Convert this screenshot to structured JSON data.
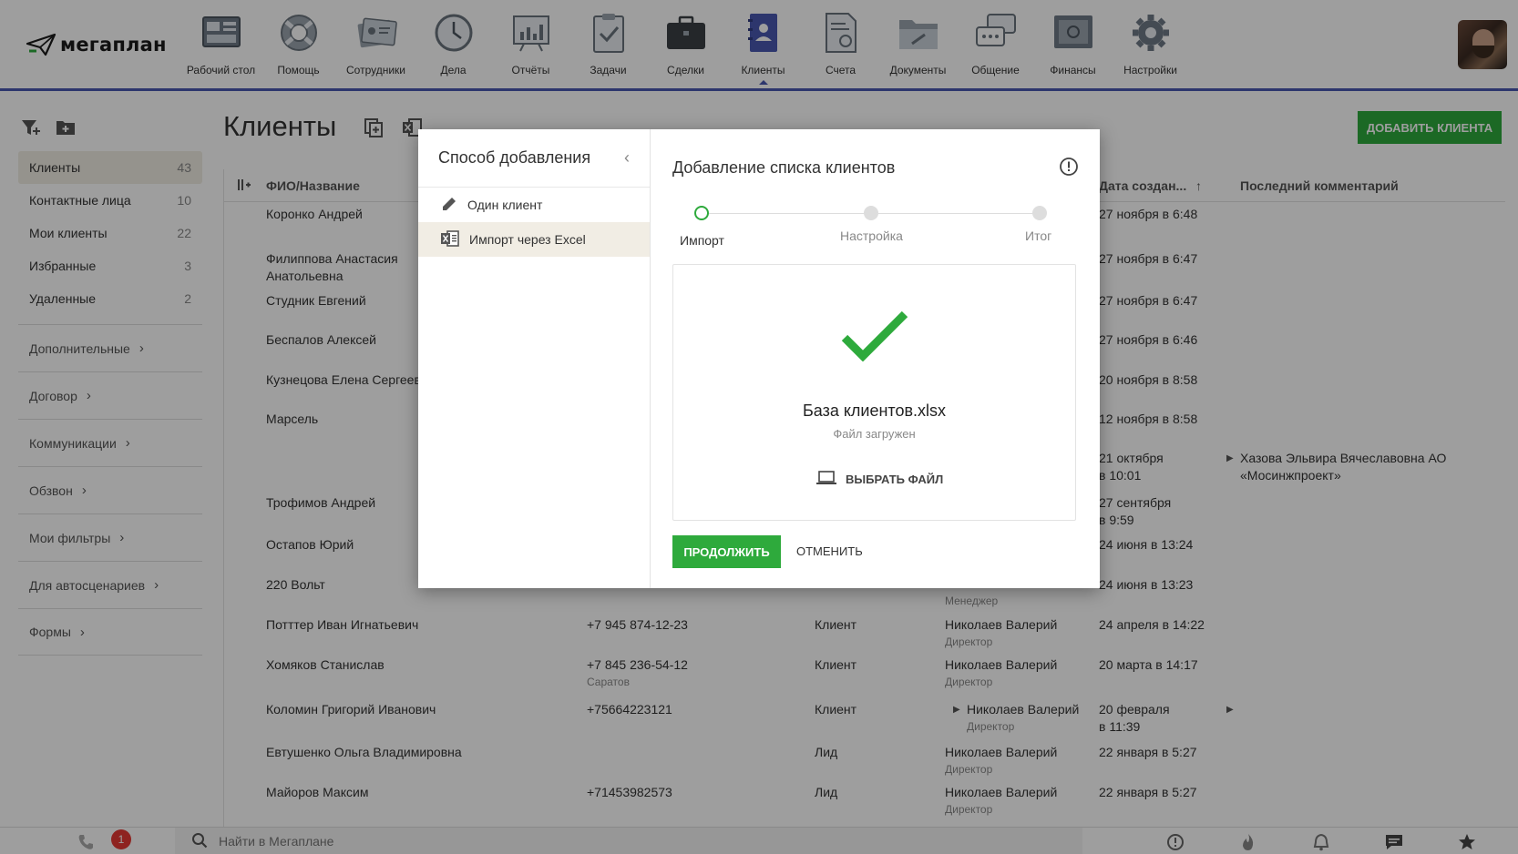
{
  "app": {
    "logo_text": "мегаплан"
  },
  "nav": [
    {
      "label": "Рабочий стол",
      "icon": "desktop-icon"
    },
    {
      "label": "Помощь",
      "icon": "lifebuoy-icon"
    },
    {
      "label": "Сотрудники",
      "icon": "employees-icon"
    },
    {
      "label": "Дела",
      "icon": "clock-icon"
    },
    {
      "label": "Отчёты",
      "icon": "chart-board-icon"
    },
    {
      "label": "Задачи",
      "icon": "clipboard-check-icon"
    },
    {
      "label": "Сделки",
      "icon": "briefcase-icon"
    },
    {
      "label": "Клиенты",
      "icon": "contacts-book-icon",
      "active": true
    },
    {
      "label": "Счета",
      "icon": "invoice-icon"
    },
    {
      "label": "Документы",
      "icon": "folder-icon"
    },
    {
      "label": "Общение",
      "icon": "chat-icon"
    },
    {
      "label": "Финансы",
      "icon": "safe-icon"
    },
    {
      "label": "Настройки",
      "icon": "gear-icon"
    }
  ],
  "sidebar": {
    "items": [
      {
        "label": "Клиенты",
        "count": "43",
        "active": true
      },
      {
        "label": "Контактные лица",
        "count": "10"
      },
      {
        "label": "Мои клиенты",
        "count": "22"
      },
      {
        "label": "Избранные",
        "count": "3"
      },
      {
        "label": "Удаленные",
        "count": "2"
      }
    ],
    "groups": [
      {
        "label": "Дополнительные"
      },
      {
        "label": "Договор"
      },
      {
        "label": "Коммуникации"
      },
      {
        "label": "Обзвон"
      },
      {
        "label": "Мои фильтры"
      },
      {
        "label": "Для автосценариев"
      },
      {
        "label": "Формы"
      }
    ]
  },
  "page": {
    "title": "Клиенты",
    "add_button": "ДОБАВИТЬ КЛИЕНТА"
  },
  "table": {
    "headers": {
      "name": "ФИО/Название",
      "date": "Дата создан...",
      "comment": "Последний комментарий"
    },
    "rows": [
      {
        "name": "Коронко Андрей",
        "date": "27 ноября в 6:48"
      },
      {
        "name": "Филиппова Анастасия",
        "name2": "Анатольевна",
        "date": "27 ноября в 6:47"
      },
      {
        "name": "Студник Евгений",
        "date": "27 ноября в 6:47"
      },
      {
        "name": "Беспалов Алексей",
        "date": "27 ноября в 6:46"
      },
      {
        "name": "Кузнецова Елена Сергеевна",
        "date": "20 ноября в 8:58"
      },
      {
        "name": "Марсель",
        "date": "12 ноября в 8:58"
      },
      {
        "name": "",
        "date": "21 октября",
        "date2": "в 10:01",
        "comment": "Хазова Эльвира Вячеславовна  АО",
        "comment2": "«Мосинжпроект»"
      },
      {
        "name": "Трофимов Андрей",
        "date": "27 сентября",
        "date2": "в 9:59"
      },
      {
        "name": "Остапов Юрий",
        "date": "24 июня в 13:24"
      },
      {
        "name": "220 Вольт",
        "manager_sub": "Менеджер",
        "date": "24 июня в 13:23"
      },
      {
        "name": "Потттер Иван Игнатьевич",
        "phone": "+7 945 874-12-23",
        "type": "Клиент",
        "manager": "Николаев Валерий",
        "manager_sub": "Директор",
        "date": "24 апреля в 14:22"
      },
      {
        "name": "Хомяков Станислав",
        "phone": "+7 845 236-54-12",
        "phone_sub": "Саратов",
        "type": "Клиент",
        "manager": "Николаев Валерий",
        "manager_sub": "Директор",
        "date": "20 марта в 14:17"
      },
      {
        "name": "Коломин Григорий Иванович",
        "phone": "+75664223121",
        "type": "Клиент",
        "manager": "Николаев Валерий",
        "manager_sub": "Директор",
        "date": "20 февраля",
        "date2": "в 11:39"
      },
      {
        "name": "Евтушенко Ольга Владимировна",
        "type": "Лид",
        "manager": "Николаев Валерий",
        "manager_sub": "Директор",
        "date": "22 января в 5:27"
      },
      {
        "name": "Майоров Максим",
        "phone": "+71453982573",
        "type": "Лид",
        "manager": "Николаев Валерий",
        "manager_sub": "Директор",
        "date": "22 января в 5:27"
      }
    ]
  },
  "bottombar": {
    "badge": "1",
    "search_placeholder": "Найти в Мегаплане"
  },
  "modal": {
    "left_title": "Способ добавления",
    "options": [
      {
        "label": "Один клиент",
        "icon": "pencil-icon"
      },
      {
        "label": "Импорт через Excel",
        "icon": "excel-icon",
        "active": true
      }
    ],
    "title": "Добавление списка клиентов",
    "steps": [
      "Импорт",
      "Настройка",
      "Итог"
    ],
    "file_name": "База клиентов.xlsx",
    "file_status": "Файл загружен",
    "choose_file": "ВЫБРАТЬ ФАЙЛ",
    "continue": "ПРОДОЛЖИТЬ",
    "cancel": "ОТМЕНИТЬ"
  },
  "colors": {
    "accent": "#2eaa3c",
    "nav_underline": "#4a58b0",
    "selected_bg": "#f1ede4",
    "badge": "#e53935"
  }
}
